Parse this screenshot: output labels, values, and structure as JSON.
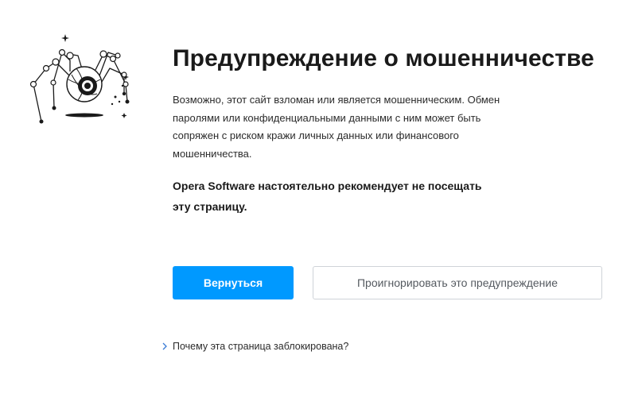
{
  "warning": {
    "title": "Предупреждение о мошенничестве",
    "description": "Возможно, этот сайт взломан или является мошенническим. Обмен паролями или конфиденциальными данными с ним может быть сопряжен с риском кражи личных данных или финансового мошенничества.",
    "recommendation": "Opera Software настоятельно рекомендует не посещать эту страницу."
  },
  "actions": {
    "back_label": "Вернуться",
    "ignore_label": "Проигнорировать это предупреждение"
  },
  "details": {
    "why_blocked_label": "Почему эта страница заблокирована?"
  },
  "colors": {
    "primary_button": "#0099ff",
    "text": "#1a1a1a"
  },
  "icons": {
    "illustration": "spider-with-eye-illustration",
    "link_chevron": "chevron-right-icon"
  }
}
